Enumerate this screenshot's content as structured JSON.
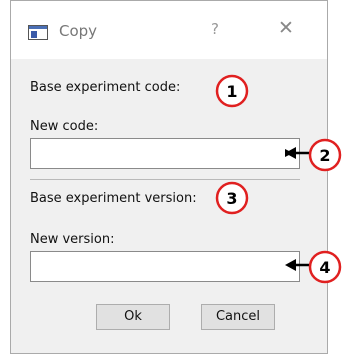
{
  "window": {
    "title": "Copy",
    "help_glyph": "?",
    "close_glyph": "✕",
    "app_icon": "window-icon"
  },
  "form": {
    "base_code_label": "Base experiment code:",
    "new_code_label": "New code:",
    "new_code_value": "",
    "base_version_label": "Base experiment version:",
    "new_version_label": "New version:",
    "new_version_value": ""
  },
  "buttons": {
    "ok_label": "Ok",
    "cancel_label": "Cancel"
  },
  "callouts": [
    "1",
    "2",
    "3",
    "4"
  ],
  "colors": {
    "callout_red": "#e02020",
    "dialog_bg": "#f0f0f0"
  }
}
